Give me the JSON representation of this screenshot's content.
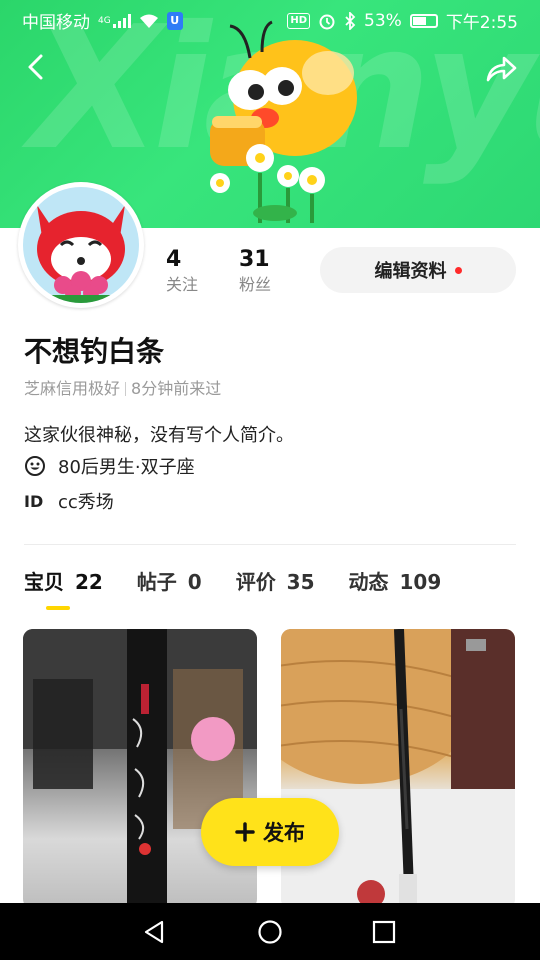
{
  "status_bar": {
    "carrier": "中国移动",
    "network": "4G",
    "battery": "53%",
    "time": "下午2:55",
    "hd": "HD"
  },
  "banner": {
    "watermark": "Xianyu"
  },
  "profile": {
    "following_count": "4",
    "following_label": "关注",
    "followers_count": "31",
    "followers_label": "粉丝",
    "edit_button": "编辑资料",
    "username": "不想钓白条",
    "credit": "芝麻信用极好",
    "last_seen": "8分钟前来过",
    "bio": "这家伙很神秘，没有写个人简介。",
    "demographic": "80后男生·双子座",
    "id_label": "ID",
    "id_value": "cc秀场"
  },
  "tabs": [
    {
      "label": "宝贝",
      "count": "22"
    },
    {
      "label": "帖子",
      "count": "0"
    },
    {
      "label": "评价",
      "count": "35"
    },
    {
      "label": "动态",
      "count": "109"
    }
  ],
  "active_tab": "宝贝",
  "publish_button": "发布",
  "colors": {
    "accent_yellow": "#ffe21a",
    "banner_green": "#2bd66a",
    "red_dot": "#ff2a2a"
  },
  "icons": [
    "back-icon",
    "share-icon",
    "smile-icon",
    "plus-icon",
    "nav-back-icon",
    "nav-home-icon",
    "nav-recents-icon"
  ]
}
